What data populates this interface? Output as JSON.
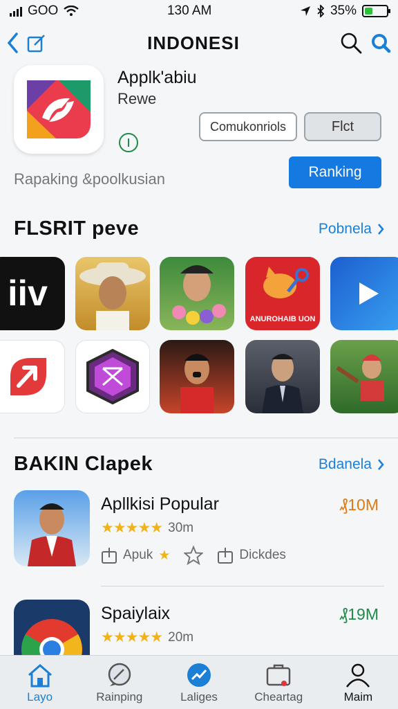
{
  "status": {
    "carrier": "GOO",
    "time": "130 AM",
    "battery": "35%",
    "battery_level": 0.35
  },
  "nav": {
    "title": "INDONESI"
  },
  "app": {
    "name": "Applk'abiu",
    "subtitle": "Rewe",
    "button_outline": "Comukonriols",
    "button_gray": "Flct",
    "tagline": "Rapaking &poolkusian",
    "button_rank": "Ranking"
  },
  "featured": {
    "title": "FLSRIT peve",
    "link": "Pobnela",
    "tiles": [
      {
        "name": "tile-iiv",
        "label": "iiv",
        "color": "#111111"
      },
      {
        "name": "tile-cowboy",
        "label": "",
        "color": "#e2b24a"
      },
      {
        "name": "tile-flowers",
        "label": "",
        "color": "#4f9a3a"
      },
      {
        "name": "tile-cat",
        "label": "ANUROHAIB UON",
        "color": "#d8262a"
      },
      {
        "name": "tile-play",
        "label": "",
        "color": "#1b6fd9"
      },
      {
        "name": "tile-red-arrow",
        "label": "",
        "color": "#ffffff"
      },
      {
        "name": "tile-hex",
        "label": "",
        "color": "#ffffff"
      },
      {
        "name": "tile-singer",
        "label": "",
        "color": "#c0392b"
      },
      {
        "name": "tile-news",
        "label": "",
        "color": "#3a3f4a"
      },
      {
        "name": "tile-sports",
        "label": "",
        "color": "#3f8a3a"
      }
    ]
  },
  "ranking": {
    "title": "BAKIN Clapek",
    "link": "Bdanela",
    "items": [
      {
        "title": "Apllkisi Popular",
        "stars": "★★★★★",
        "count": "30m",
        "price": "₰10M",
        "price_color": "#e07a10",
        "action1": "Apuk",
        "action3": "Dickdes"
      },
      {
        "title": "Spaiylaix",
        "stars": "★★★★★",
        "count": "20m",
        "price": "₰19M",
        "price_color": "#1f8a4a"
      }
    ]
  },
  "tabs": [
    {
      "label": "Layo",
      "icon": "home-icon",
      "active": true
    },
    {
      "label": "Rainping",
      "icon": "chat-icon",
      "active": false
    },
    {
      "label": "Laliges",
      "icon": "trend-icon",
      "active": false
    },
    {
      "label": "Cheartag",
      "icon": "briefcase-icon",
      "active": false
    },
    {
      "label": "Maim",
      "icon": "person-icon",
      "active": false
    }
  ],
  "colors": {
    "accent": "#1479e0",
    "star": "#f1b31c"
  }
}
